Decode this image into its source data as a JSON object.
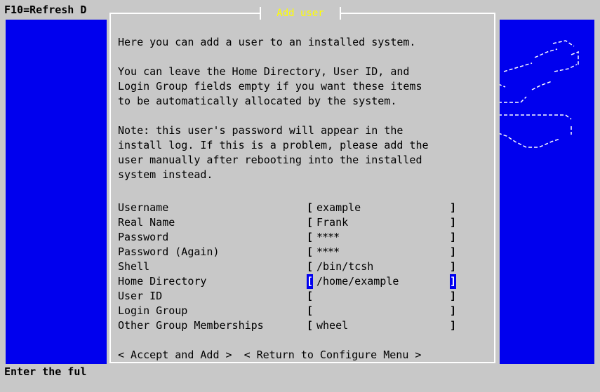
{
  "topbar": {
    "text": "F10=Refresh D"
  },
  "bottombar": {
    "text": "Enter the ful"
  },
  "logo": {
    "name": "freebsd-ascii-logo-icon"
  },
  "dialog": {
    "title": " Add user ",
    "intro": "Here you can add a user to an installed system.",
    "paragraph2": "You can leave the Home Directory, User ID, and\nLogin Group fields empty if you want these items\nto be automatically allocated by the system.",
    "paragraph3": "Note: this user's password will appear in the\ninstall log. If this is a problem, please add the\nuser manually after rebooting into the installed\nsystem instead."
  },
  "form": {
    "username": {
      "label": "Username",
      "value": "example"
    },
    "realname": {
      "label": "Real Name",
      "value": "Frank"
    },
    "password": {
      "label": "Password",
      "value": "****"
    },
    "password_again": {
      "label": "Password (Again)",
      "value": "****"
    },
    "shell": {
      "label": "Shell",
      "value": "/bin/tcsh"
    },
    "home_directory": {
      "label": "Home Directory",
      "value": "/home/example"
    },
    "user_id": {
      "label": "User ID",
      "value": ""
    },
    "login_group": {
      "label": "Login Group",
      "value": ""
    },
    "other_groups": {
      "label": "Other Group Memberships",
      "value": "wheel"
    },
    "bracket_left": "[",
    "bracket_right": "]"
  },
  "buttons": {
    "accept": "< Accept and Add >",
    "return": "< Return to Configure Menu >"
  },
  "colors": {
    "background": "#c8c8c8",
    "screen_blue": "#0000ee",
    "title_yellow": "#ffff00",
    "frame_white": "#ffffff"
  }
}
